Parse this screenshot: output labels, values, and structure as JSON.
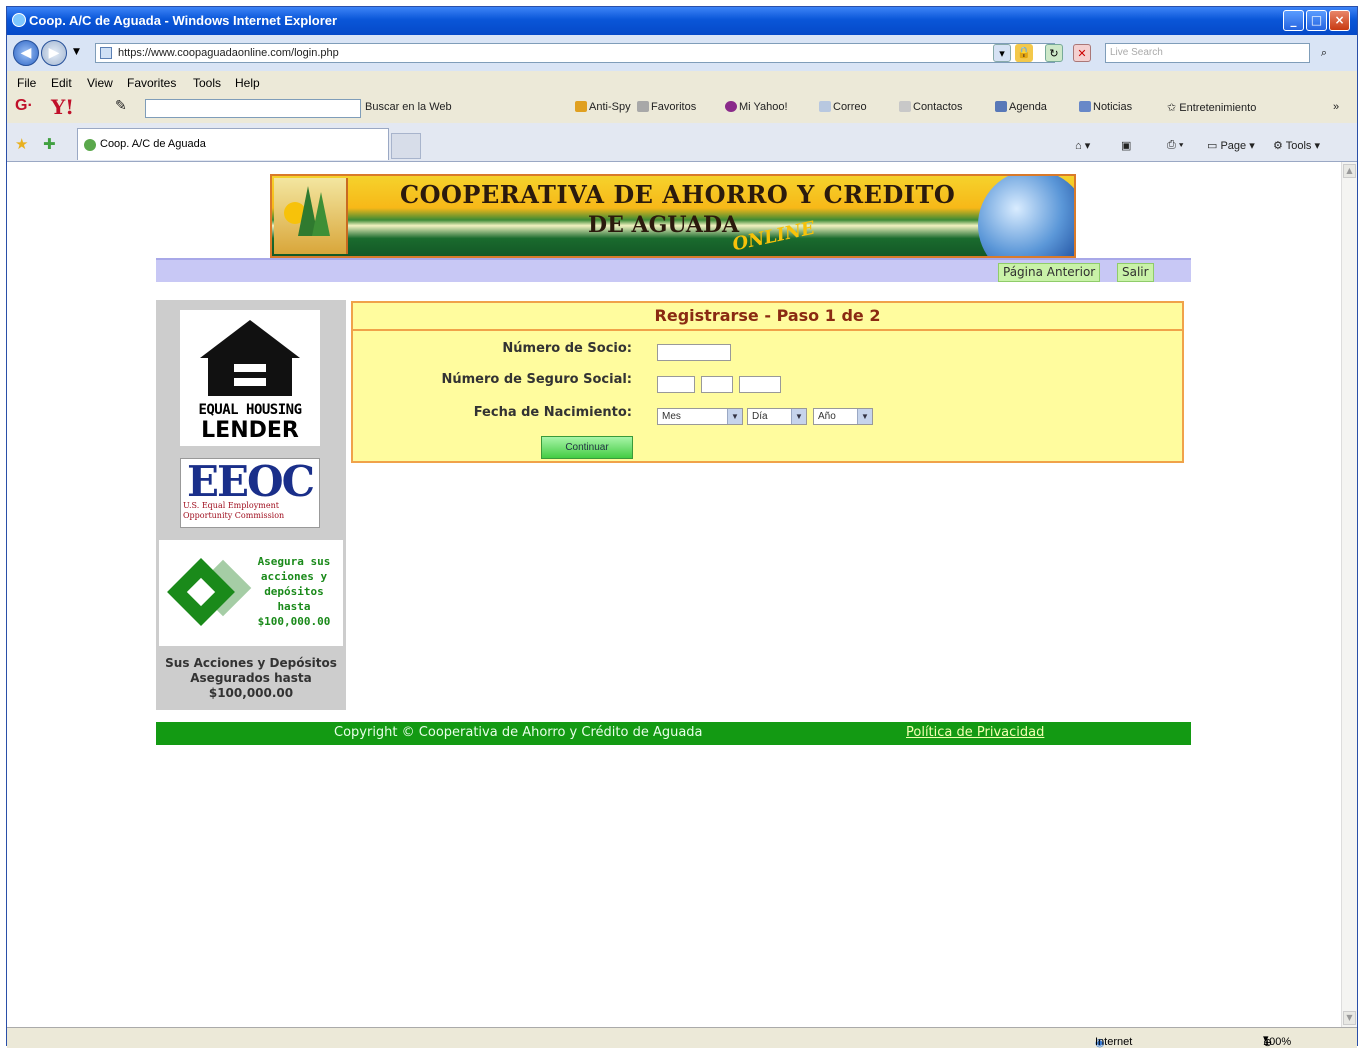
{
  "window": {
    "title": "Coop. A/C de Aguada - Windows Internet Explorer",
    "minimize": "_",
    "maximize": "□",
    "close": "×"
  },
  "address": {
    "url": "https://www.coopaguadaonline.com/login.php",
    "search_placeholder": "Live Search"
  },
  "menu": [
    "File",
    "Edit",
    "View",
    "Favorites",
    "Tools",
    "Help"
  ],
  "yahoo_toolbar": {
    "search_button": "Buscar en la Web",
    "items": [
      "Anti-Spy",
      "Favoritos",
      "Mi Yahoo!",
      "Correo",
      "Contactos",
      "Agenda",
      "Noticias",
      "Entretenimiento"
    ],
    "more": "»"
  },
  "tab": {
    "title": "Coop. A/C de Aguada"
  },
  "commands": {
    "page": "Page",
    "tools": "Tools"
  },
  "page": {
    "banner_line1": "COOPERATIVA DE AHORRO Y CREDITO",
    "banner_line2": "DE AGUADA",
    "banner_line3": "ONLINE",
    "nav": {
      "back": "Página Anterior",
      "logout": "Salir"
    },
    "sidebar": {
      "ehl_line1": "EQUAL HOUSING",
      "ehl_line2": "LENDER",
      "eeoc_big": "EEOC",
      "eeoc_small": "U.S. Equal Employment Opportunity Commission",
      "ncua_text": "Asegura sus acciones y depósitos hasta $100,000.00",
      "caption": "Sus Acciones y Depósitos Asegurados hasta $100,000.00"
    },
    "form": {
      "title": "Registrarse - Paso 1 de 2",
      "member_label": "Número de Socio:",
      "ssn_label": "Número de Seguro Social:",
      "dob_label": "Fecha de Nacimiento:",
      "month": "Mes",
      "day": "Día",
      "year": "Año",
      "submit": "Continuar"
    },
    "footer": {
      "copyright": "Copyright © Cooperativa de Ahorro y Crédito de Aguada",
      "privacy": "Política de Privacidad"
    }
  },
  "status": {
    "zone": "Internet",
    "zoom": "100%"
  },
  "colors": {
    "titlebar": "#0a56d8",
    "form_bg": "#fffc9e",
    "form_border": "#f0a24a",
    "footer": "#139a13",
    "nav_strip": "#c8c8f5"
  }
}
